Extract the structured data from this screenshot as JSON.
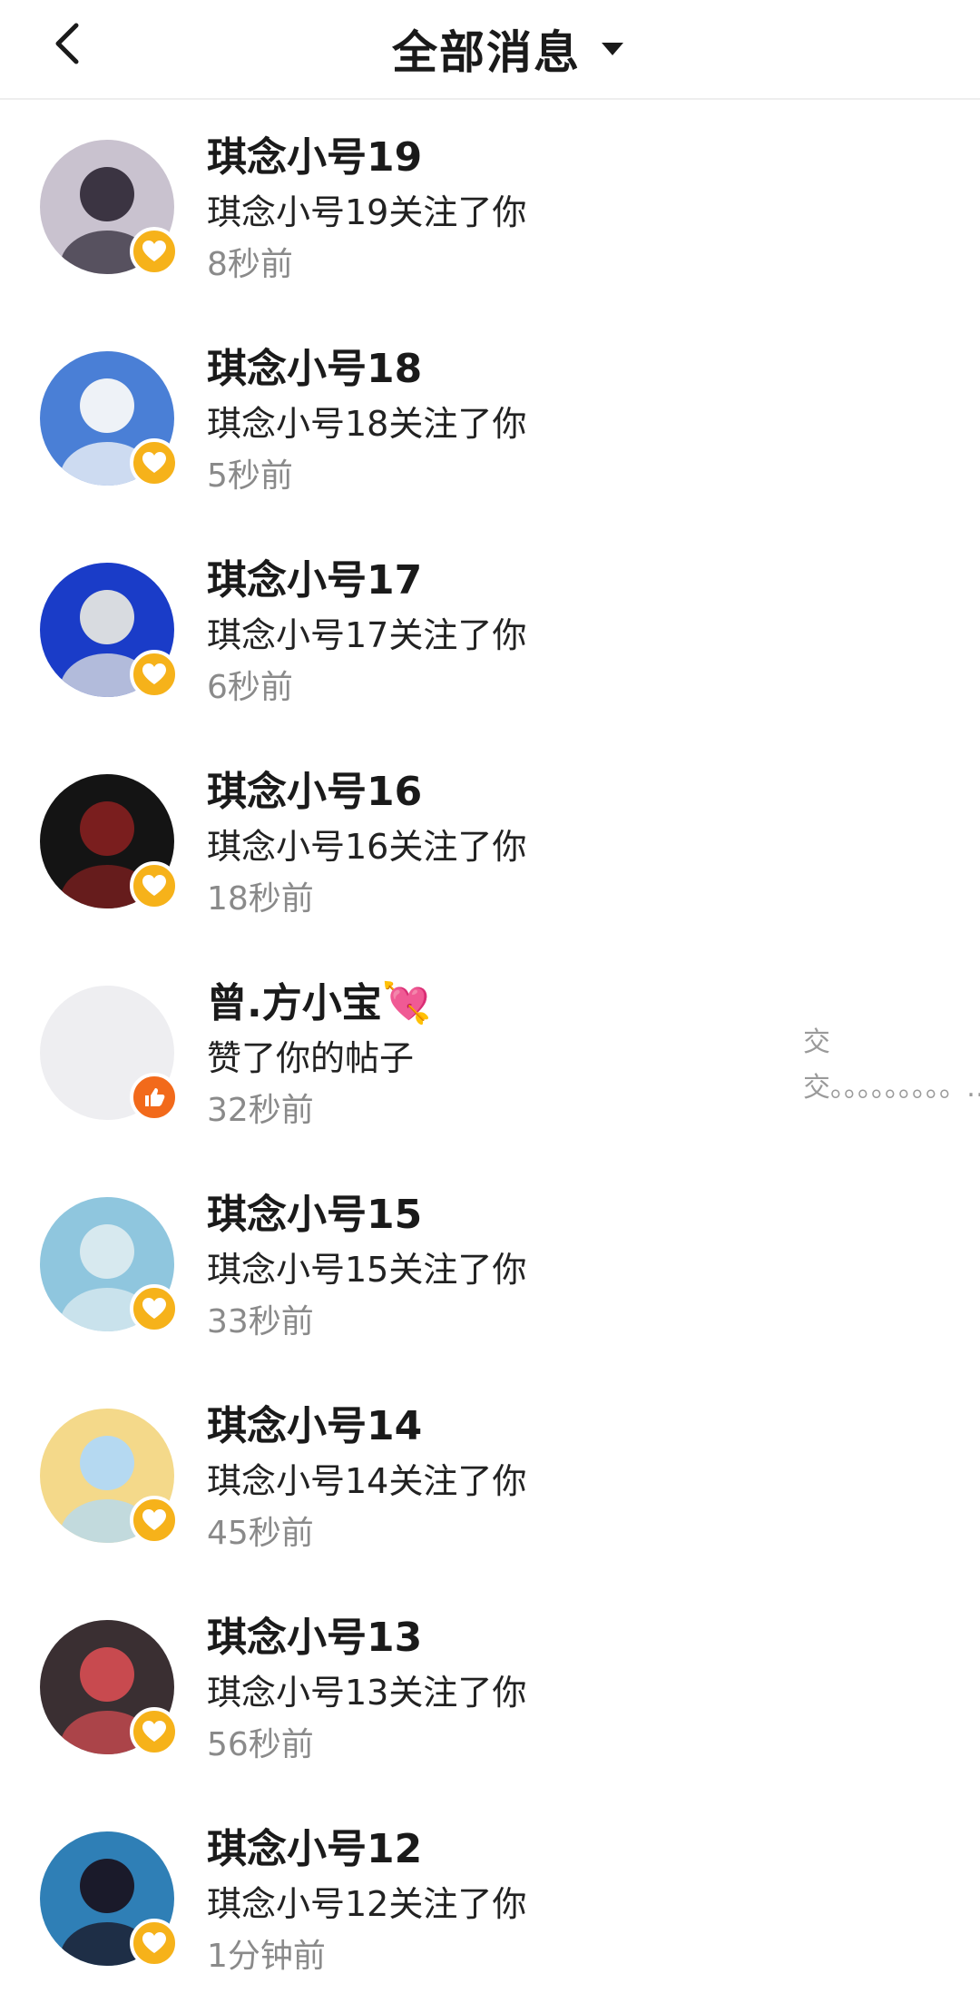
{
  "header": {
    "title": "全部消息",
    "back_icon": "chevron-left-icon",
    "dropdown_icon": "caret-down-icon"
  },
  "colors": {
    "follow_badge": "#F6B21A",
    "like_badge": "#F26A1B",
    "name": "#1a1a1a",
    "time": "#8a8a8a"
  },
  "notifications": [
    {
      "name": "琪念小号19",
      "action": "琪念小号19关注了你",
      "time": "8秒前",
      "type": "follow",
      "avatar_color": "#c9c2cf",
      "avatar_accent": "#3b3442"
    },
    {
      "name": "琪念小号18",
      "action": "琪念小号18关注了你",
      "time": "5秒前",
      "type": "follow",
      "avatar_color": "#4a7fd6",
      "avatar_accent": "#eef2f7"
    },
    {
      "name": "琪念小号17",
      "action": "琪念小号17关注了你",
      "time": "6秒前",
      "type": "follow",
      "avatar_color": "#1a3cc8",
      "avatar_accent": "#d8dbe0"
    },
    {
      "name": "琪念小号16",
      "action": "琪念小号16关注了你",
      "time": "18秒前",
      "type": "follow",
      "avatar_color": "#141414",
      "avatar_accent": "#7a1e1e"
    },
    {
      "name": "曾.方小宝💘",
      "action": "赞了你的帖子",
      "time": "32秒前",
      "type": "like",
      "avatar_color": "#eeeef1",
      "avatar_accent": "#eeeef1",
      "preview": "交交。。。。。。。。。…"
    },
    {
      "name": "琪念小号15",
      "action": "琪念小号15关注了你",
      "time": "33秒前",
      "type": "follow",
      "avatar_color": "#8fc6de",
      "avatar_accent": "#d7e9ef"
    },
    {
      "name": "琪念小号14",
      "action": "琪念小号14关注了你",
      "time": "45秒前",
      "type": "follow",
      "avatar_color": "#f4d98a",
      "avatar_accent": "#b5d9f1"
    },
    {
      "name": "琪念小号13",
      "action": "琪念小号13关注了你",
      "time": "56秒前",
      "type": "follow",
      "avatar_color": "#3a2f32",
      "avatar_accent": "#c84a4f"
    },
    {
      "name": "琪念小号12",
      "action": "琪念小号12关注了你",
      "time": "1分钟前",
      "type": "follow",
      "avatar_color": "#2f7fb6",
      "avatar_accent": "#1a1a2a"
    }
  ]
}
